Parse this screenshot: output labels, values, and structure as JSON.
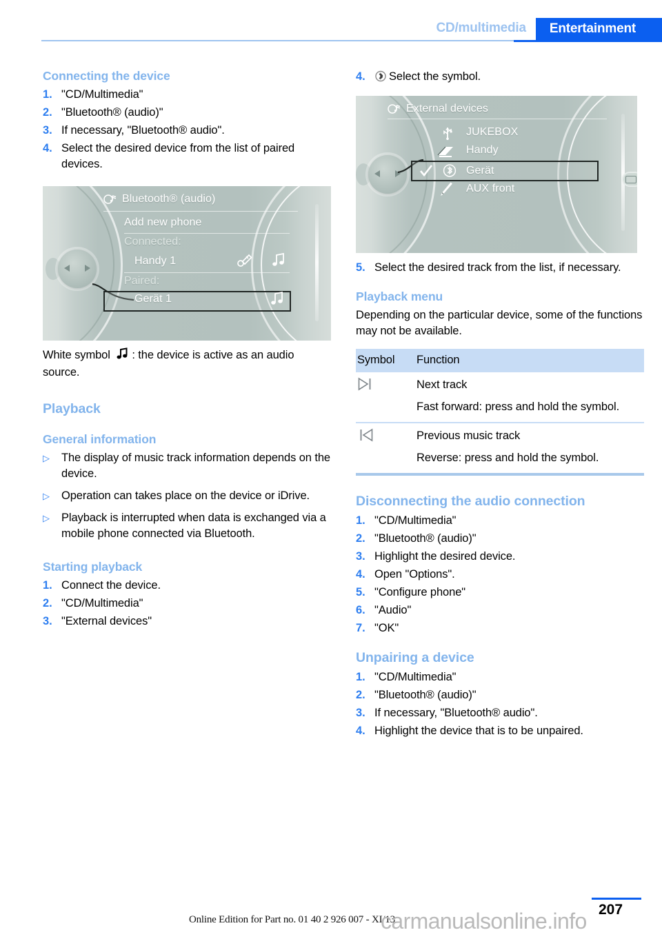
{
  "header": {
    "tab_inactive": "CD/multimedia",
    "tab_active": "Entertainment",
    "accent_blue": "#0b5ff0",
    "light_blue": "#9dc3f0"
  },
  "left": {
    "connecting": {
      "heading": "Connecting the device",
      "steps": [
        "\"CD/Multimedia\"",
        "\"Bluetooth® (audio)\"",
        "If necessary, \"Bluetooth® audio\".",
        "Select the desired device from the list of paired devices."
      ],
      "numbers": [
        "1.",
        "2.",
        "3.",
        "4."
      ]
    },
    "screenshot_bt": {
      "title": "Bluetooth® (audio)",
      "rows": [
        {
          "label": "Add new phone"
        },
        {
          "label": "Connected:"
        },
        {
          "label": "Handy 1"
        },
        {
          "label": "Paired:"
        },
        {
          "label": "Gerät 1"
        }
      ]
    },
    "white_symbol_note_before": "White symbol",
    "white_symbol_note_after": ": the device is active as an audio source.",
    "playback": {
      "heading": "Playback",
      "general_heading": "General information",
      "bullets": [
        "The display of music track information depends on the device.",
        "Operation can takes place on the device or iDrive.",
        "Playback is interrupted when data is exchanged via a mobile phone connected via Bluetooth."
      ]
    },
    "starting": {
      "heading": "Starting playback",
      "numbers": [
        "1.",
        "2.",
        "3."
      ],
      "steps": [
        "Connect the device.",
        "\"CD/Multimedia\"",
        "\"External devices\""
      ]
    }
  },
  "right": {
    "step4": {
      "number": "4.",
      "text": "Select the symbol."
    },
    "screenshot_ext": {
      "title": "External devices",
      "rows": [
        {
          "icon": "usb-icon",
          "label": "JUKEBOX",
          "checked": false
        },
        {
          "icon": "phone-icon",
          "label": "Handy",
          "checked": false
        },
        {
          "icon": "bluetooth-icon",
          "label": "Gerät",
          "checked": true
        },
        {
          "icon": "aux-icon",
          "label": "AUX front",
          "checked": false
        }
      ]
    },
    "step5": {
      "number": "5.",
      "text": "Select the desired track from the list, if necessary."
    },
    "playback_menu": {
      "heading": "Playback menu",
      "intro": "Depending on the particular device, some of the functions may not be available.",
      "columns": [
        "Symbol",
        "Function"
      ],
      "rows": [
        {
          "symbol": "next-track-icon",
          "lines": [
            "Next track",
            "Fast forward: press and hold the symbol."
          ]
        },
        {
          "symbol": "previous-track-icon",
          "lines": [
            "Previous music track",
            "Reverse: press and hold the symbol."
          ]
        }
      ]
    },
    "disconnecting": {
      "heading": "Disconnecting the audio connection",
      "numbers": [
        "1.",
        "2.",
        "3.",
        "4.",
        "5.",
        "6.",
        "7."
      ],
      "steps": [
        "\"CD/Multimedia\"",
        "\"Bluetooth® (audio)\"",
        "Highlight the desired device.",
        "Open \"Options\".",
        "\"Configure phone\"",
        "\"Audio\"",
        "\"OK\""
      ]
    },
    "unpairing": {
      "heading": "Unpairing a device",
      "numbers": [
        "1.",
        "2.",
        "3.",
        "4."
      ],
      "steps": [
        "\"CD/Multimedia\"",
        "\"Bluetooth® (audio)\"",
        "If necessary, \"Bluetooth® audio\".",
        "Highlight the device that is to be unpaired."
      ]
    }
  },
  "footer": {
    "online_edition": "Online Edition for Part no. 01 40 2 926 007 - XI/13",
    "watermark": "carmanualsonline.info",
    "page_number": "207"
  }
}
